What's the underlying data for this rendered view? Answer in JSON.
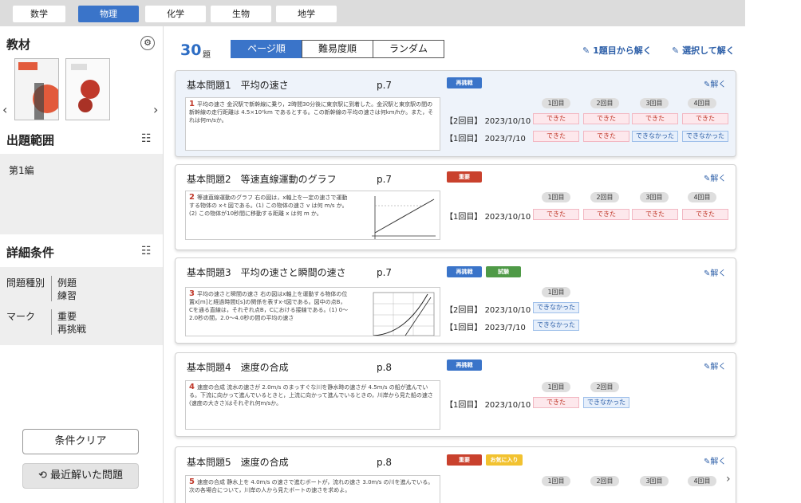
{
  "subjects": [
    {
      "label": "数学",
      "active": false
    },
    {
      "label": "物理",
      "active": true
    },
    {
      "label": "化学",
      "active": false
    },
    {
      "label": "生物",
      "active": false
    },
    {
      "label": "地学",
      "active": false
    }
  ],
  "sidebar": {
    "material_title": "教材",
    "range_title": "出題範囲",
    "range_value": "第1編",
    "detail_title": "詳細条件",
    "type_label": "問題種別",
    "type_values": [
      "例題",
      "練習"
    ],
    "mark_label": "マーク",
    "mark_values": [
      "重要",
      "再挑戦"
    ],
    "clear_button": "条件クリア",
    "recent_button": "最近解いた問題"
  },
  "toolbar": {
    "count": "30",
    "count_unit": "題",
    "sort_options": [
      "ページ順",
      "難易度順",
      "ランダム"
    ],
    "start_link": "1題目から解く",
    "select_link": "選択して解く"
  },
  "colors": {
    "accent": "#3a74c9",
    "done": "#c0392b",
    "notdone": "#2d5fa8"
  },
  "cards": [
    {
      "title": "基本問題1　平均の速さ",
      "page": "p.7",
      "tags": [
        {
          "label": "再挑戦",
          "color": "blue"
        }
      ],
      "solve": "解く",
      "thumb_num": "1",
      "thumb_text": "平均の速さ 金沢駅で新幹線に乗り，2時間30分後に東京駅に到着した。金沢駅と東京駅の間の新幹線の走行距離は 4.5×10²km であるとする。この新幹線の平均の速さは何km/hか。また，それは何m/sか。",
      "rounds": [
        "1回目",
        "2回目",
        "3回目",
        "4回目"
      ],
      "rows": [
        {
          "label": "【2回目】",
          "date": "2023/10/10",
          "results": [
            "できた",
            "できた",
            "できた",
            "できた"
          ]
        },
        {
          "label": "【1回目】",
          "date": "2023/7/10",
          "results": [
            "できた",
            "できた",
            "できなかった",
            "できなかった"
          ]
        }
      ]
    },
    {
      "title": "基本問題2　等速直線運動のグラフ",
      "page": "p.7",
      "tags": [
        {
          "label": "重要",
          "color": "red"
        }
      ],
      "solve": "解く",
      "thumb_num": "2",
      "thumb_text": "等速直線運動のグラフ 右の図は，x軸上を一定の速さで運動する物体の x-t 図である。(1) この物体の速さ v は何 m/s か。(2) この物体が10秒間に移動する距離 x は何 m か。",
      "rounds": [
        "1回目",
        "2回目",
        "3回目",
        "4回目"
      ],
      "rows": [
        {
          "label": "【1回目】",
          "date": "2023/10/10",
          "results": [
            "できた",
            "できた",
            "できた",
            "できた"
          ]
        }
      ]
    },
    {
      "title": "基本問題3　平均の速さと瞬間の速さ",
      "page": "p.7",
      "tags": [
        {
          "label": "再挑戦",
          "color": "blue"
        },
        {
          "label": "試験",
          "color": "green"
        }
      ],
      "solve": "解く",
      "thumb_num": "3",
      "thumb_text": "平均の速さと瞬間の速さ 右の図はx軸上を運動する物体の位置x[m]と経過時間t[s]の関係を表すx-t図である。図中の点B，Cを通る直線は，それぞれ点B，Cにおける接線である。(1) 0～2.0秒の間，2.0～4.0秒の間の平均の速さ",
      "rounds": [
        "1回目"
      ],
      "rows": [
        {
          "label": "【2回目】",
          "date": "2023/10/10",
          "results": [
            "できなかった"
          ]
        },
        {
          "label": "【1回目】",
          "date": "2023/7/10",
          "results": [
            "できなかった"
          ]
        }
      ]
    },
    {
      "title": "基本問題4　速度の合成",
      "page": "p.8",
      "tags": [
        {
          "label": "再挑戦",
          "color": "blue"
        }
      ],
      "solve": "解く",
      "thumb_num": "4",
      "thumb_text": "速度の合成 流水の速さが 2.0m/s のまっすぐな川を静水時の速さが 4.5m/s の船が進んでいる。下流に向かって進んでいるときと，上流に向かって進んでいるときの，川岸から見た船の速さ(速度の大きさ)はそれぞれ何m/sか。",
      "rounds": [
        "1回目",
        "2回目"
      ],
      "rows": [
        {
          "label": "【1回目】",
          "date": "2023/10/10",
          "results": [
            "できた",
            "できなかった"
          ]
        }
      ]
    },
    {
      "title": "基本問題5　速度の合成",
      "page": "p.8",
      "tags": [
        {
          "label": "重要",
          "color": "red"
        },
        {
          "label": "お気に入り",
          "color": "yellow"
        }
      ],
      "solve": "解く",
      "thumb_num": "5",
      "thumb_text": "速度の合成 静水上を 4.0m/s の速さで進むボートが，流れの速さ 3.0m/s の川を進んでいる。次の各場合について，川岸の人から見たボートの速さを求めよ。",
      "rounds": [
        "1回目",
        "2回目",
        "3回目",
        "4回目"
      ],
      "rows": []
    }
  ]
}
